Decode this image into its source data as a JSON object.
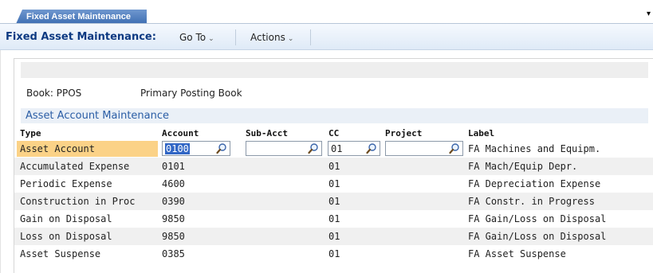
{
  "tab": {
    "label": "Fixed Asset Maintenance",
    "menu_glyph": "▾"
  },
  "titlebar": {
    "title": "Fixed Asset Maintenance:",
    "goto_label": "Go To",
    "actions_label": "Actions",
    "chevron": "⌄"
  },
  "book": {
    "label": "Book: PPOS",
    "name": "Primary Posting Book"
  },
  "section": {
    "title": "Asset Account Maintenance"
  },
  "columns": {
    "type": "Type",
    "account": "Account",
    "sub_acct": "Sub-Acct",
    "cc": "CC",
    "project": "Project",
    "label": "Label"
  },
  "edit_row": {
    "type": "Asset Account",
    "account": "0100",
    "sub_acct": "",
    "cc": "01",
    "project": "",
    "label": "FA Machines and Equipm."
  },
  "rows": [
    {
      "type": "Accumulated Expense",
      "account": "0101",
      "cc": "01",
      "label": "FA Mach/Equip Depr."
    },
    {
      "type": "Periodic Expense",
      "account": "4600",
      "cc": "01",
      "label": "FA Depreciation Expense"
    },
    {
      "type": "Construction in Proc",
      "account": "0390",
      "cc": "01",
      "label": "FA Constr. in Progress"
    },
    {
      "type": "Gain on Disposal",
      "account": "9850",
      "cc": "01",
      "label": "FA Gain/Loss on Disposal"
    },
    {
      "type": "Loss on Disposal",
      "account": "9850",
      "cc": "01",
      "label": "FA Gain/Loss on Disposal"
    },
    {
      "type": "Asset Suspense",
      "account": "0385",
      "cc": "01",
      "label": "FA Asset Suspense"
    }
  ],
  "colors": {
    "tab_blue": "#3f6fb3",
    "title_blue": "#0d3a82",
    "section_blue": "#2a5da5",
    "highlight": "#fbd287",
    "selection": "#3166c5"
  },
  "icons": {
    "lookup": "magnifier-icon"
  }
}
